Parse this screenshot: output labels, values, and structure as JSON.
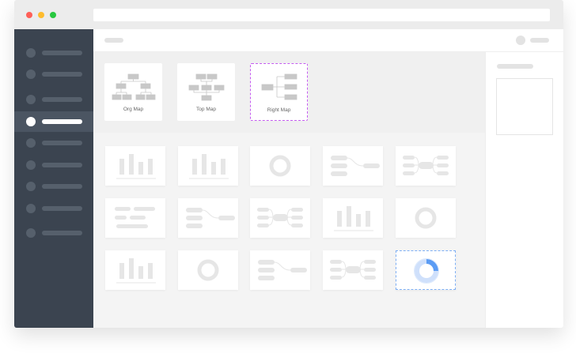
{
  "window": {
    "dots": [
      "#fe5f57",
      "#febc2e",
      "#28c840"
    ]
  },
  "sidebar": {
    "item_count": 9,
    "active_index": 3
  },
  "templates": [
    {
      "label": "Org  Map",
      "icon": "org-map-icon"
    },
    {
      "label": "Top Map",
      "icon": "top-map-icon"
    },
    {
      "label": "Right Map",
      "icon": "right-map-icon",
      "selected": true
    }
  ],
  "cards": [
    [
      "bar",
      "bar",
      "donut",
      "right",
      "mind"
    ],
    [
      "text",
      "right",
      "mind",
      "bar",
      "donut"
    ],
    [
      "bar",
      "donut",
      "right",
      "mind",
      "donut-blue"
    ]
  ],
  "colors": {
    "accent": "#5b9cf4",
    "selected_template": "#c55cf0"
  }
}
